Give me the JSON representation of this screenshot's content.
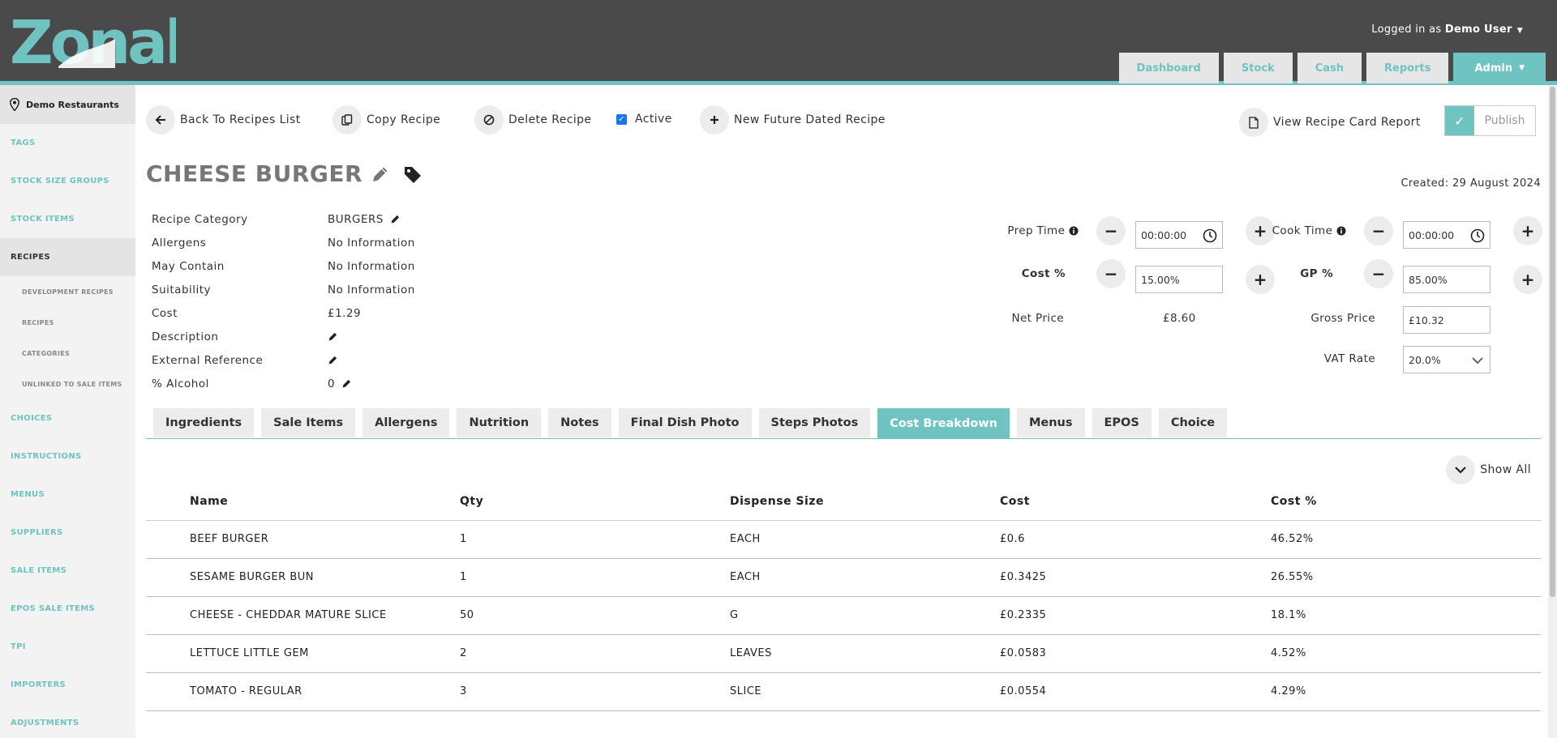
{
  "header": {
    "logo": "Zonal",
    "logged_prefix": "Logged in as",
    "user": "Demo User",
    "nav": [
      "Dashboard",
      "Stock",
      "Cash",
      "Reports"
    ],
    "admin": "Admin"
  },
  "sidebar": {
    "org": "Demo Restaurants",
    "items_top": [
      "TAGS",
      "STOCK SIZE GROUPS",
      "STOCK ITEMS"
    ],
    "active": "RECIPES",
    "sub": [
      "DEVELOPMENT RECIPES",
      "RECIPES",
      "CATEGORIES",
      "UNLINKED TO SALE ITEMS"
    ],
    "items_bottom": [
      "CHOICES",
      "INSTRUCTIONS",
      "MENUS",
      "SUPPLIERS",
      "SALE ITEMS",
      "EPOS SALE ITEMS",
      "TPI",
      "IMPORTERS",
      "ADJUSTMENTS"
    ]
  },
  "actions": {
    "back": "Back To Recipes List",
    "copy": "Copy Recipe",
    "delete": "Delete Recipe",
    "active": "Active",
    "new_future": "New Future Dated Recipe",
    "view_report": "View Recipe Card Report",
    "publish": "Publish"
  },
  "recipe": {
    "title": "CHEESE BURGER",
    "created": "Created: 29 August 2024",
    "fields": [
      {
        "k": "Recipe Category",
        "v": "BURGERS"
      },
      {
        "k": "Allergens",
        "v": "No Information"
      },
      {
        "k": "May Contain",
        "v": "No Information"
      },
      {
        "k": "Suitability",
        "v": "No Information"
      },
      {
        "k": "Cost",
        "v": "£1.29"
      },
      {
        "k": "Description",
        "v": ""
      },
      {
        "k": "External Reference",
        "v": ""
      },
      {
        "k": "% Alcohol",
        "v": "0"
      }
    ]
  },
  "pricing": {
    "prep_label": "Prep Time",
    "prep_value": "00:00:00",
    "cook_label": "Cook Time",
    "cook_value": "00:00:00",
    "cost_pct_label": "Cost %",
    "cost_pct_value": "15.00%",
    "gp_label": "GP %",
    "gp_value": "85.00%",
    "net_label": "Net Price",
    "net_value": "£8.60",
    "gross_label": "Gross Price",
    "gross_value": "£10.32",
    "vat_label": "VAT Rate",
    "vat_value": "20.0%"
  },
  "tabs": [
    "Ingredients",
    "Sale Items",
    "Allergens",
    "Nutrition",
    "Notes",
    "Final Dish Photo",
    "Steps Photos",
    "Cost Breakdown",
    "Menus",
    "EPOS",
    "Choice"
  ],
  "active_tab": "Cost Breakdown",
  "show_all": "Show All",
  "table": {
    "headers": [
      "Name",
      "Qty",
      "Dispense Size",
      "Cost",
      "Cost %"
    ],
    "rows": [
      [
        "BEEF BURGER",
        "1",
        "EACH",
        "£0.6",
        "46.52%"
      ],
      [
        "SESAME BURGER BUN",
        "1",
        "EACH",
        "£0.3425",
        "26.55%"
      ],
      [
        "CHEESE - CHEDDAR MATURE SLICE",
        "50",
        "G",
        "£0.2335",
        "18.1%"
      ],
      [
        "LETTUCE LITTLE GEM",
        "2",
        "LEAVES",
        "£0.0583",
        "4.52%"
      ],
      [
        "TOMATO - REGULAR",
        "3",
        "SLICE",
        "£0.0554",
        "4.29%"
      ]
    ]
  },
  "colors": {
    "accent": "#6fc3c0",
    "header": "#4a4a4a",
    "checkbox": "#1a73e8"
  }
}
